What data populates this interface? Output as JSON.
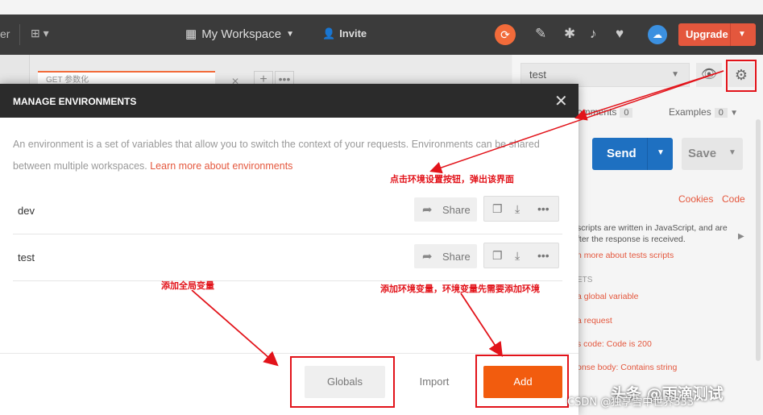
{
  "header": {
    "left_fragment": "er",
    "workspace_label": "My Workspace",
    "invite_label": "Invite",
    "upgrade_label": "Upgrade"
  },
  "tabs": {
    "active_tab_label": "GET 参数化"
  },
  "right_panel": {
    "environment_selected": "test",
    "comments_label": "omments",
    "comments_count": "0",
    "examples_label": "Examples",
    "examples_count": "0",
    "send_label": "Send",
    "save_label": "Save",
    "cookies_link": "Cookies",
    "code_link": "Code",
    "script_info": "scripts are written in JavaScript, and are fter the response is received.",
    "script_link": "n more about tests scripts",
    "snippets_header": "ETS",
    "snippets": [
      "a global variable",
      "a request",
      "s code: Code is 200",
      "onse body: Contains string"
    ]
  },
  "modal": {
    "title": "MANAGE ENVIRONMENTS",
    "description": "An environment is a set of variables that allow you to switch the context of your requests. Environments can be shared between multiple workspaces.",
    "learn_more": "Learn more about environments",
    "environments": [
      {
        "name": "dev"
      },
      {
        "name": "test"
      }
    ],
    "share_label": "Share",
    "globals_label": "Globals",
    "import_label": "Import",
    "add_label": "Add"
  },
  "annotations": {
    "settings_note": "点击环境设置按钮，弹出该界面",
    "globals_note": "添加全局变量",
    "add_note": "添加环境变量，环境变量先需要添加环境"
  },
  "watermarks": {
    "toutiao": "头条 @雨滴测试",
    "csdn": "CSDN @独享雪中世界333"
  },
  "colors": {
    "accent": "#f26b3a",
    "send_blue": "#1e70c1",
    "add_orange": "#f25c0e",
    "annotation_red": "#e2131a"
  }
}
